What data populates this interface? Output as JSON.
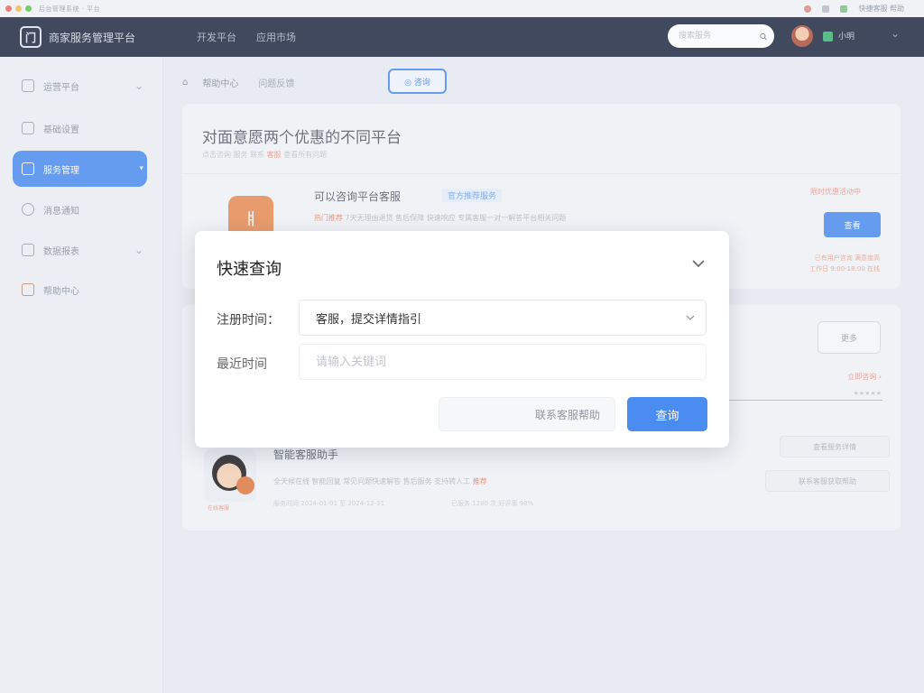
{
  "browser": {
    "title": "后台管理系统 · 平台",
    "right_text": "快捷客服 帮助"
  },
  "topnav": {
    "logo_glyph": "门",
    "brand": "商家服务管理平台",
    "links": [
      "开发平台",
      "应用市场"
    ],
    "search_placeholder": "搜索服务",
    "user_name": "小明"
  },
  "sidebar": {
    "items": [
      {
        "label": "运营平台",
        "expandable": true
      },
      {
        "label": "基础设置",
        "expandable": false
      },
      {
        "label": "服务管理",
        "expandable": true,
        "active": true
      },
      {
        "label": "消息通知",
        "expandable": false
      },
      {
        "label": "数据报表",
        "expandable": true
      },
      {
        "label": "帮助中心",
        "expandable": false
      }
    ]
  },
  "main": {
    "breadcrumb_first": "帮助中心",
    "breadcrumb_second": "问题反馈",
    "outline_button": "◎ 咨询",
    "card_title": "对面意愿两个优惠的不同平台",
    "card_subtitle": "点击咨询 服务 联系",
    "card_subtitle_warn": "客服",
    "card_subtitle_tail": "查看所有问题",
    "item1": {
      "icon_glyph": "ㅒ",
      "title": "可以咨询平台客服",
      "tag": "官方推荐服务",
      "desc_hl": "热门推荐",
      "desc": "7天无理由退货 售后保障 快速响应 专属客服一对一解答平台相关问题",
      "price": "限时优惠活动中",
      "button": "查看",
      "note_line1": "已有用户咨询 满意度高",
      "note_line2": "工作日 9:00-18:00 在线"
    },
    "ghost_button": "更多",
    "note_red2": "立即咨询 ›",
    "note_grey2": "★★★★★",
    "item2": {
      "title": "智能客服助手",
      "desc_hl": "推荐",
      "desc": "全天候在线 智能回复 常见问题快速解答 售后服务 支持转人工",
      "face_caption": "在线客服",
      "meta1": "服务时间 2024-01-01 至 2024-12-31",
      "meta2": "已服务 1280 次 好评率 98%",
      "btn1": "查看服务详情",
      "btn2": "联系客服获取帮助"
    }
  },
  "modal": {
    "title": "快速查询",
    "field1_label": "注册时间：",
    "field1_value": "客服，提交详情指引",
    "field2_label": "最近时间",
    "field2_placeholder": "请输入关键词",
    "cancel_label": "联系客服帮助",
    "ok_label": "查询"
  },
  "colors": {
    "nav_bg": "#1e2740",
    "primary": "#4a8cf0",
    "accent_orange": "#ea8a51"
  }
}
